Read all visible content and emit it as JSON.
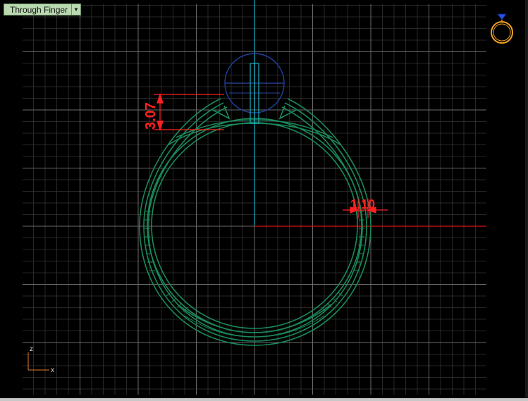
{
  "viewport": {
    "view_name": "Through Finger",
    "dropdown_glyph": "▼"
  },
  "dimensions": {
    "height_dim": "3.07",
    "thickness_dim": "1.10"
  },
  "axes": {
    "z_label": "z",
    "x_label": "x"
  },
  "icons": {
    "view_cube": "ring-preview-icon"
  },
  "colors": {
    "background": "#000000",
    "grid": "#3c3c3c",
    "ring": "#1a8a5a",
    "vertical_axis": "#1ab0c0",
    "horizontal_axis": "#e01010",
    "dimension": "#ff2020",
    "gem": "#2040a0",
    "label_bg": "#b9d9b0"
  }
}
